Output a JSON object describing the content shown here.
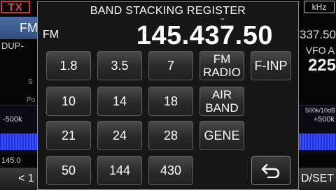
{
  "background": {
    "tx_badge": "TX",
    "mode_button": "FM",
    "dup_label": "DUP",
    "khz_badge": "kHz",
    "right_freq_fragment": "337.50",
    "vfo_label": "VFO A",
    "right_digits_fragment": "225",
    "left_scope_label": "-500k",
    "right_scope_label": "+500k",
    "right_scale_label": "500k/10dB",
    "left_freq_fragment": "145.0",
    "bottom_left_button": "< 1",
    "bottom_right_button": "D/SET",
    "small_s": "S",
    "small_po": "Po"
  },
  "dialog": {
    "title": "BAND STACKING REGISTER",
    "mode": "FM",
    "frequency": "145.437.50",
    "buttons": {
      "b1_8": "1.8",
      "b3_5": "3.5",
      "b7": "7",
      "fm_radio_l1": "FM",
      "fm_radio_l2": "RADIO",
      "finp": "F-INP",
      "b10": "10",
      "b14": "14",
      "b18": "18",
      "air_band_l1": "AIR",
      "air_band_l2": "BAND",
      "b21": "21",
      "b24": "24",
      "b28": "28",
      "gene": "GENE",
      "b50": "50",
      "b144": "144",
      "b430": "430"
    },
    "back_icon": "return-arrow-icon"
  },
  "colors": {
    "tx_red": "#d23a2c",
    "mode_blue": "#3a5a8f",
    "scope_blue": "#3d52ff"
  }
}
